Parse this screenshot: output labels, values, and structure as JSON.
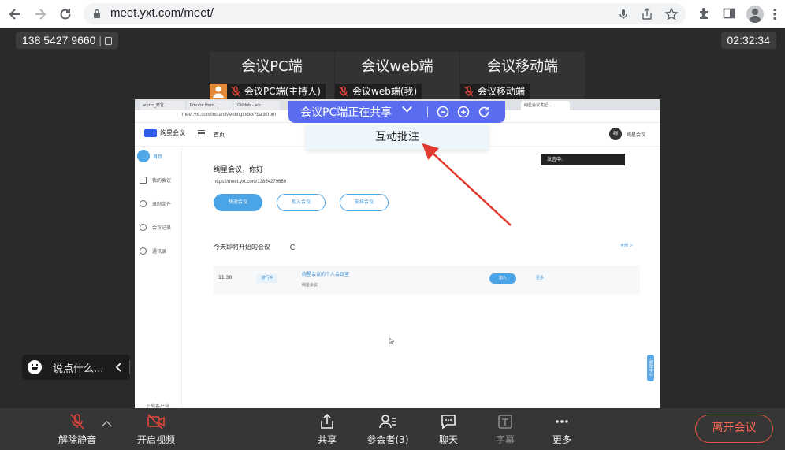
{
  "browser": {
    "url": "meet.yxt.com/meet/"
  },
  "meeting": {
    "phone": "138 5427 9660",
    "timer": "02:32:34"
  },
  "tiles": [
    {
      "title": "会议PC端",
      "label": "会议PC端(主持人)"
    },
    {
      "title": "会议web端",
      "label": "会议web端(我)"
    },
    {
      "title": "会议移动端",
      "label": "会议移动端"
    }
  ],
  "sharebar": {
    "text": "会议PC端正在共享"
  },
  "annotation_popup": {
    "label": "互动批注"
  },
  "shared_screen": {
    "tabs": [
      "aiortc_开发...",
      "Private Hom...",
      "GitHub - aio...",
      "绚星会议发起..."
    ],
    "address": "meet.yxt.com/instantMeetingIndex?backfrom",
    "app_name": "绚星会议",
    "breadcrumb": "首页",
    "user_avatar": "绚",
    "user_name": "绚星会议",
    "nav": [
      {
        "label": "首页",
        "active": true
      },
      {
        "label": "我的会议"
      },
      {
        "label": "录制文件"
      },
      {
        "label": "会议记录"
      },
      {
        "label": "通讯录"
      }
    ],
    "greeting": "绚星会议，你好",
    "meeting_link": "https://meet.yxt.com/13854279660",
    "buttons": {
      "quick": "快速会议",
      "join": "加入会议",
      "schedule": "安排会议"
    },
    "speaking": "发言中:",
    "today_title": "今天即将开始的会议",
    "all_link": "全部 >",
    "meeting_row": {
      "time": "11:30",
      "status": "进行中",
      "title": "绚星会议的个人会议室",
      "subtitle": "绚星会议",
      "join": "加入",
      "more": "更多"
    },
    "help_tab": "帮助中心",
    "download": "下载客户端"
  },
  "chat": {
    "placeholder": "说点什么..."
  },
  "toolbar": {
    "unmute": "解除静音",
    "video": "开启视频",
    "share": "共享",
    "participants": "参会者(3)",
    "chat": "聊天",
    "captions": "字幕",
    "more": "更多",
    "leave": "离开会议"
  },
  "colors": {
    "share_bar": "#5a6cf0",
    "host_badge": "#e18a3a",
    "muted_red": "#e0453a",
    "leave_red": "#e0543f",
    "annotation_arrow": "#e03a2e"
  }
}
